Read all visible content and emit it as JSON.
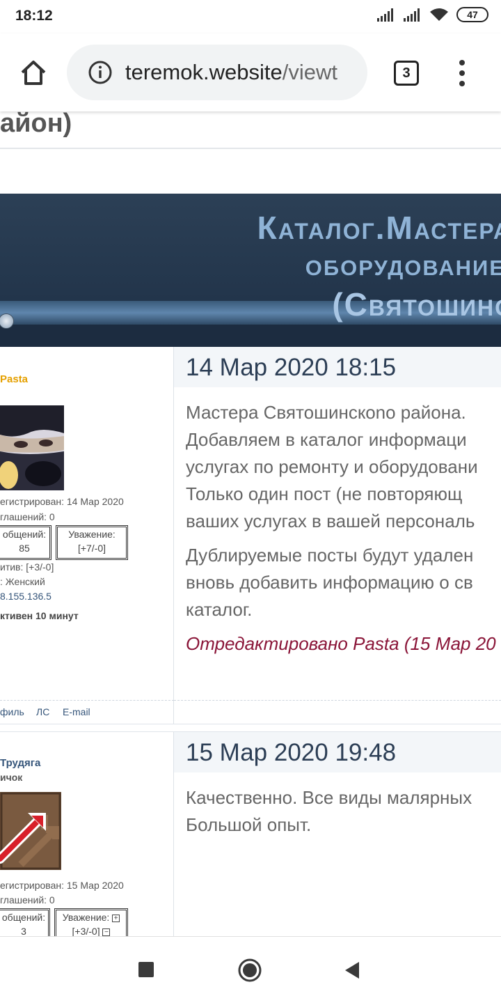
{
  "status": {
    "time": "18:12",
    "battery": "47"
  },
  "browser": {
    "url_host": "teremok.website",
    "url_path": "/viewt",
    "tab_count": "3"
  },
  "page": {
    "title_fragment": "айон)",
    "banner_lines": [
      "Каталог.Мастера",
      "оборудование",
      "(Святошино"
    ]
  },
  "posts": [
    {
      "author": "Pasta",
      "rank": "",
      "registered": "егистрирован: 14 Мар 2020",
      "agreements": "глашений: 0",
      "messages_label": "общений:",
      "messages_value": "85",
      "respect_label": "Уважение:",
      "respect_value": "[+7/-0]",
      "positive": "итив: [+3/-0]",
      "gender": ": Женский",
      "ip": "8.155.136.5",
      "activity": "ктивен 10 минут",
      "footer": [
        "филь",
        "ЛС",
        "E-mail"
      ],
      "date": "14 Мар 2020 18:15",
      "paragraphs": [
        [
          "Мастера Святошинскono района.",
          "Добавляем в каталог информаци",
          "услугах по ремонту и оборудовани",
          "Только один пост (не повторяющ",
          "ваших услугах в вашей персональ"
        ],
        [
          "Дублируемые посты будут удален",
          "вновь добавить информацию о св",
          "каталог."
        ]
      ],
      "edited": "Отредактировано Pasta (15 Мар 20"
    },
    {
      "author": "Трудяга",
      "rank": "ичок",
      "registered": "егистрирован: 15 Мар 2020",
      "agreements": "глашений: 0",
      "messages_label": "общений:",
      "messages_value": "3",
      "respect_label": "Уважение:",
      "respect_value": "[+3/-0]",
      "respect_plus": "+",
      "respect_minus": "−",
      "date": "15 Мар 2020 19:48",
      "paragraphs": [
        [
          "Качественно. Все виды малярных",
          "Большой опыт."
        ]
      ]
    }
  ]
}
